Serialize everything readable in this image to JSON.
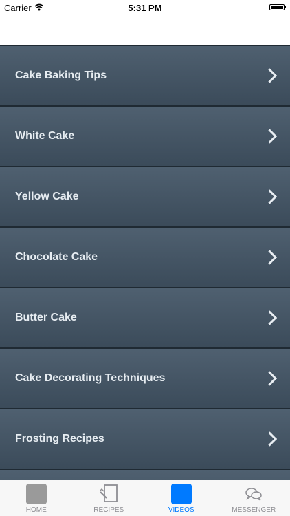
{
  "status_bar": {
    "carrier": "Carrier",
    "time": "5:31 PM"
  },
  "list": {
    "items": [
      {
        "label": "Cake Baking Tips"
      },
      {
        "label": "White Cake"
      },
      {
        "label": "Yellow Cake"
      },
      {
        "label": "Chocolate Cake"
      },
      {
        "label": "Butter Cake"
      },
      {
        "label": "Cake Decorating Techniques"
      },
      {
        "label": "Frosting Recipes"
      }
    ]
  },
  "tab_bar": {
    "tabs": [
      {
        "label": "HOME",
        "icon": "home-icon"
      },
      {
        "label": "RECIPES",
        "icon": "recipes-icon"
      },
      {
        "label": "VIDEOS",
        "icon": "videos-icon",
        "active": true
      },
      {
        "label": "MESSENGER",
        "icon": "messenger-icon"
      }
    ]
  },
  "colors": {
    "accent": "#007aff",
    "row_background": "#45566a",
    "row_text": "#e6ecf1",
    "tab_inactive": "#8e8e93"
  }
}
